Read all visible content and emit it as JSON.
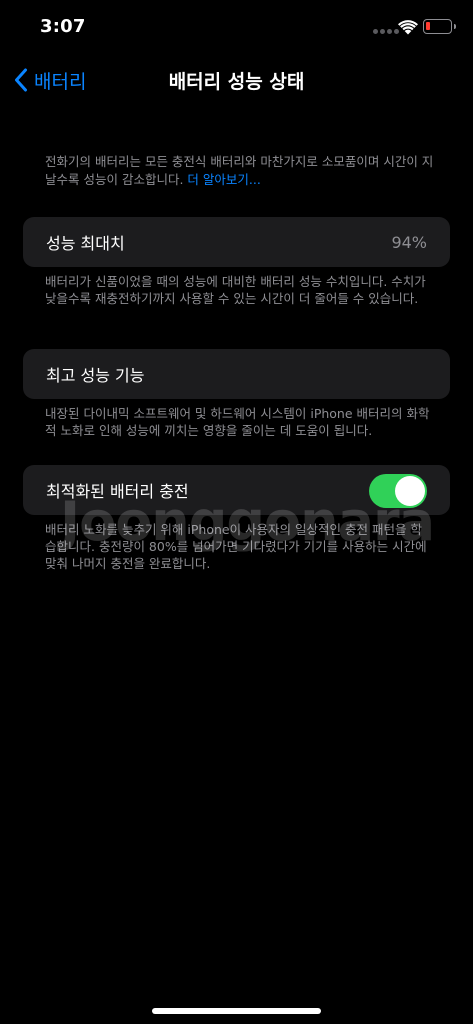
{
  "status_bar": {
    "time": "3:07",
    "battery_color": "#ff3b30"
  },
  "nav": {
    "back_label": "배터리",
    "title": "배터리 성능 상태"
  },
  "intro": {
    "text": "전화기의 배터리는 모든 충전식 배터리와 마찬가지로 소모품이며 시간이 지날수록 성능이 감소합니다. ",
    "link": "더 알아보기..."
  },
  "max_capacity": {
    "title": "성능 최대치",
    "value": "94%",
    "footnote": "배터리가 신품이었을 때의 성능에 대비한 배터리 성능 수치입니다. 수치가 낮을수록 재충전하기까지 사용할 수 있는 시간이 더 줄어들 수 있습니다."
  },
  "peak_performance": {
    "title": "최고 성능 기능",
    "footnote": "내장된 다이내믹 소프트웨어 및 하드웨어 시스템이 iPhone 배터리의 화학적 노화로 인해 성능에 끼치는 영향을 줄이는 데 도움이 됩니다."
  },
  "optimized_charging": {
    "title": "최적화된 배터리 충전",
    "enabled": true,
    "toggle_color": "#30d158",
    "footnote": "배터리 노화를 늦추기 위해 iPhone이 사용자의 일상적인 충전 패턴을 학습합니다. 충전량이 80%를 넘어가면 기다렸다가 기기를 사용하는 시간에 맞춰 나머지 충전을 완료합니다."
  },
  "watermark": "Joonggonara",
  "colors": {
    "accent": "#0a84ff",
    "cell_background": "#1c1c1e",
    "secondary_text": "#8e8e93"
  }
}
